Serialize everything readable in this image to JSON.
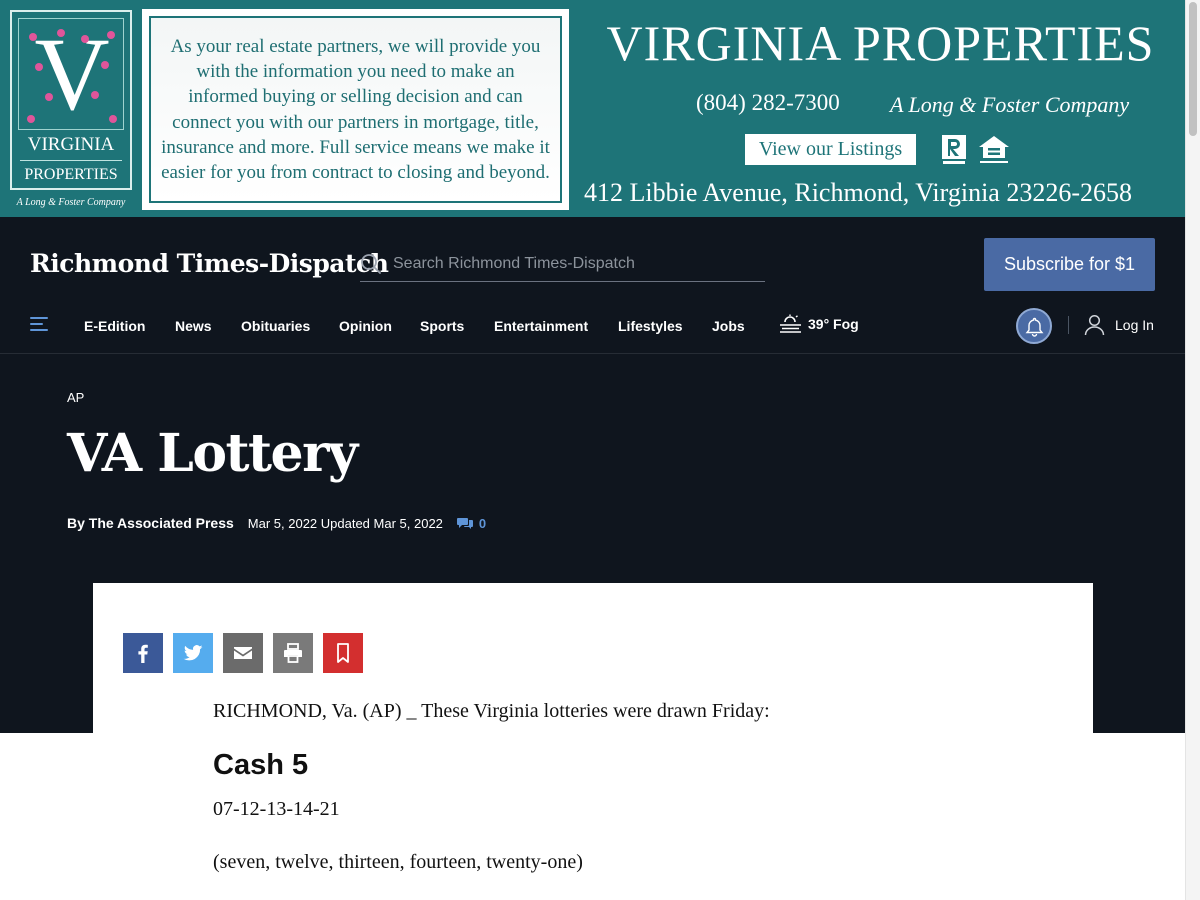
{
  "ad": {
    "logo_letter": "V",
    "logo_name_line1": "VIRGINIA",
    "logo_name_line2": "PROPERTIES",
    "logo_tagline": "A Long & Foster Company",
    "message": "As your real estate partners, we will provide you with the information you need to make an informed buying or selling decision and can connect you with our partners in mortgage, title, insurance and more. Full service means we make it easier for you from contract to closing and beyond.",
    "brand": "VIRGINIA PROPERTIES",
    "phone": "(804) 282-7300",
    "long_foster": "A Long & Foster Company",
    "listings_button": "View our Listings",
    "address": "412 Libbie Avenue, Richmond, Virginia 23226-2658",
    "realtor_icon": "realtor-r-icon",
    "equal_housing_icon": "equal-housing-icon",
    "colors": {
      "teal": "#1e7478",
      "pink": "#e0559a"
    }
  },
  "header": {
    "masthead": "Richmond Times-Dispatch",
    "search_placeholder": "Search Richmond Times-Dispatch",
    "subscribe_label": "Subscribe for $1",
    "colors": {
      "background": "#0f151e",
      "accent": "#4a6aa4",
      "link": "#5f95d8"
    }
  },
  "nav": {
    "menu_icon": "hamburger-icon",
    "items": [
      "E-Edition",
      "News",
      "Obituaries",
      "Opinion",
      "Sports",
      "Entertainment",
      "Lifestyles",
      "Jobs"
    ],
    "weather": {
      "icon": "fog-icon",
      "text": "39° Fog"
    },
    "notifications_icon": "bell-icon",
    "login_label": "Log In",
    "login_icon": "user-icon"
  },
  "article": {
    "section": "AP",
    "headline": "VA Lottery",
    "byline": "By The Associated Press",
    "dates": "Mar 5, 2022 Updated Mar 5, 2022",
    "comment_count": "0",
    "share_buttons": [
      {
        "name": "facebook",
        "icon": "facebook-icon",
        "color": "#3b5998"
      },
      {
        "name": "twitter",
        "icon": "twitter-icon",
        "color": "#55acee"
      },
      {
        "name": "email",
        "icon": "envelope-icon",
        "color": "#6b6b6b"
      },
      {
        "name": "print",
        "icon": "printer-icon",
        "color": "#7a7a7a"
      },
      {
        "name": "save",
        "icon": "bookmark-icon",
        "color": "#d32f2f"
      }
    ],
    "lead": "RICHMOND, Va. (AP) _ These Virginia lotteries were drawn Friday:",
    "game_title": "Cash 5",
    "numbers": "07-12-13-14-21",
    "numbers_words": "(seven, twelve, thirteen, fourteen, twenty-one)"
  }
}
